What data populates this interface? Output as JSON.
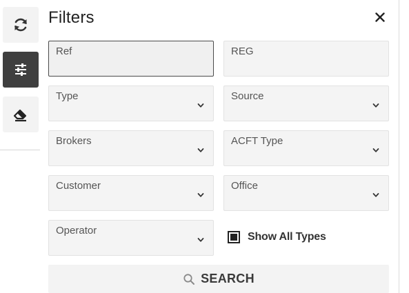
{
  "rail": {
    "items": [
      {
        "icon": "refresh-icon",
        "active": false
      },
      {
        "icon": "sliders-icon",
        "active": true
      },
      {
        "icon": "eraser-icon",
        "active": false
      }
    ]
  },
  "panel": {
    "title": "Filters",
    "close_icon": "close-icon"
  },
  "fields": {
    "ref": {
      "label": "Ref",
      "value": ""
    },
    "reg": {
      "label": "REG",
      "value": ""
    },
    "type": {
      "label": "Type",
      "value": ""
    },
    "source": {
      "label": "Source",
      "value": ""
    },
    "brokers": {
      "label": "Brokers",
      "value": ""
    },
    "acft_type": {
      "label": "ACFT Type",
      "value": ""
    },
    "customer": {
      "label": "Customer",
      "value": ""
    },
    "office": {
      "label": "Office",
      "value": ""
    },
    "operator": {
      "label": "Operator",
      "value": ""
    }
  },
  "show_all_types": {
    "label": "Show All Types",
    "checked": true
  },
  "search": {
    "label": "SEARCH",
    "icon": "search-icon"
  },
  "colors": {
    "rail_active_bg": "#3f3f3f",
    "field_bg": "#f4f4f4",
    "text": "#222222"
  }
}
